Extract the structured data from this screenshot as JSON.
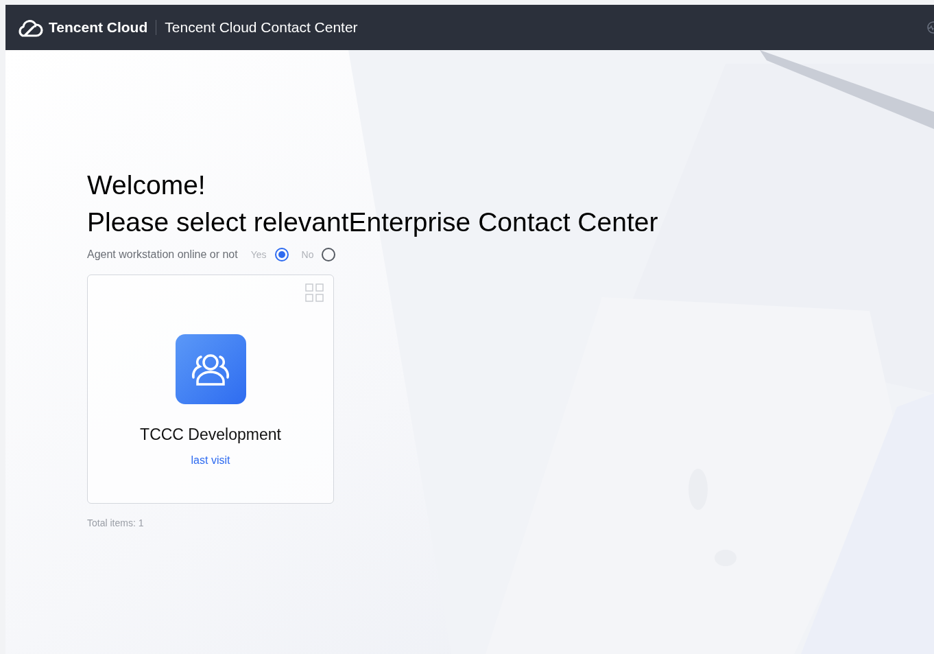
{
  "header": {
    "brand": "Tencent Cloud",
    "product": "Tencent Cloud Contact Center"
  },
  "welcome": {
    "title": "Welcome!",
    "subtitle": "Please select relevantEnterprise Contact Center"
  },
  "agent_online": {
    "label": "Agent workstation online or not",
    "options": [
      {
        "label": "Yes",
        "selected": true
      },
      {
        "label": "No",
        "selected": false
      }
    ]
  },
  "centers": [
    {
      "name": "TCCC Development",
      "link": "last visit"
    }
  ],
  "total": "Total items:  1"
}
